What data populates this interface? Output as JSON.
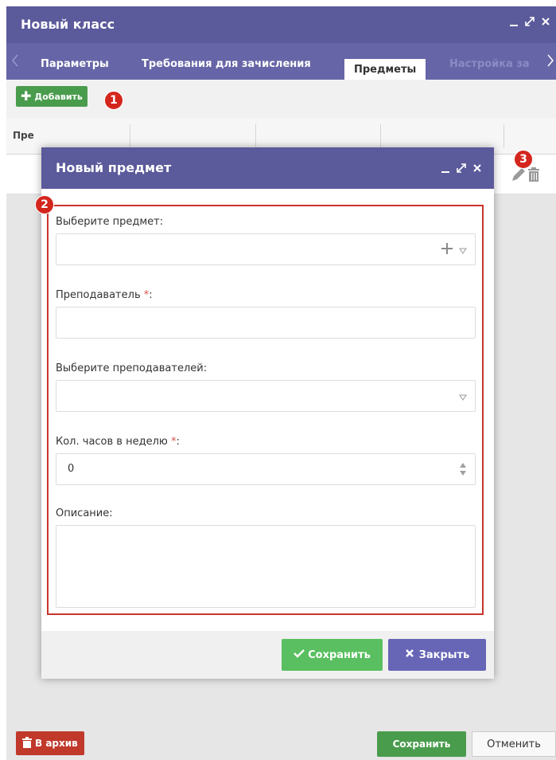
{
  "outer_window": {
    "title": "Новый класс",
    "tabs": [
      {
        "label": "Параметры"
      },
      {
        "label": "Требования для зачисления"
      },
      {
        "label": "Предметы"
      },
      {
        "label": "Настройка за"
      }
    ],
    "toolbar": {
      "add_label": "Добавить"
    },
    "table": {
      "header_label": "Пре"
    },
    "footer": {
      "archive_label": "В архив",
      "save_label": "Сохранить",
      "cancel_label": "Отменить"
    }
  },
  "badges": [
    "1",
    "2",
    "3"
  ],
  "modal": {
    "title": "Новый предмет",
    "fields": {
      "subject_label": "Выберите предмет:",
      "teacher_label": "Преподаватель",
      "teachers_label": "Выберите преподавателей:",
      "hours_label": "Кол. часов в неделю",
      "hours_value": "0",
      "description_label": "Описание:"
    },
    "required_mark": "*",
    "colon": ":",
    "save_label": "Сохранить",
    "close_label": "Закрыть"
  },
  "colors": {
    "header_purple": "#5b5a9b",
    "tabs_purple": "#6665a7",
    "green": "#4a9c4d",
    "modal_save_green": "#59bf60",
    "close_purple": "#6665b6",
    "badge_red": "#d4261d",
    "archive_red": "#c0392b"
  }
}
